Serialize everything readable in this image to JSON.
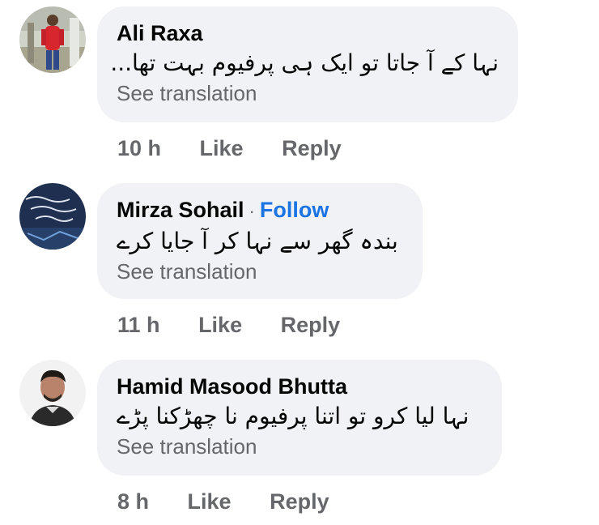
{
  "comments": [
    {
      "author": "Ali Raxa",
      "follow": "",
      "text": "نہا کے آ جاتا تو ایک ہی پرفیوم بہت تھا...",
      "see_translation": "See translation",
      "time": "10 h",
      "like": "Like",
      "reply": "Reply"
    },
    {
      "author": "Mirza Sohail",
      "dot": "·",
      "follow": "Follow",
      "text": "بندہ گھر سے نہا کر آ جایا کرے",
      "see_translation": "See translation",
      "time": "11 h",
      "like": "Like",
      "reply": "Reply"
    },
    {
      "author": "Hamid Masood Bhutta",
      "follow": "",
      "text": "نہا لیا کرو تو اتنا پرفیوم نا چھڑکنا پڑے",
      "see_translation": "See translation",
      "time": "8 h",
      "like": "Like",
      "reply": "Reply"
    }
  ],
  "colors": {
    "bubble": "#f0f2f5",
    "secondary_text": "#65676b",
    "follow": "#1b74e4",
    "primary_text": "#050505"
  },
  "icons": {
    "avatar_1": "person-in-red-shirt-photo",
    "avatar_2": "dark-blue-urdu-poetry-image",
    "avatar_3": "man-portrait-photo"
  }
}
